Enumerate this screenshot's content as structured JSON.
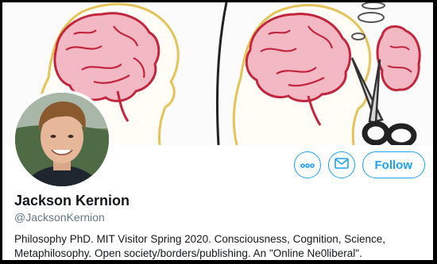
{
  "profile": {
    "name": "Jackson Kernion",
    "handle": "@JacksonKernion",
    "bio": "Philosophy PhD. MIT Visitor Spring 2020. Consciousness, Cognition, Science, Metaphilosophy. Open society/borders/publishing. An \"Online Ne0liberal\"."
  },
  "actions": {
    "more_icon": "more-options-icon",
    "message_icon": "envelope-icon",
    "follow_label": "Follow"
  },
  "colors": {
    "accent": "#1da1f2",
    "name_text": "#14171a",
    "handle_text": "#657786",
    "brain_pink": "#e88a9d",
    "brain_outline": "#c2263d",
    "head_outline": "#e6c35a"
  }
}
